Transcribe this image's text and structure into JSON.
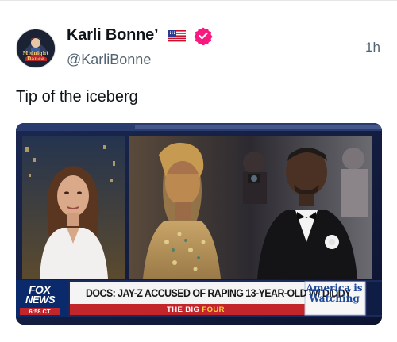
{
  "author": {
    "name": "Karli Bonne’",
    "flag_icon": "us-flag-icon",
    "verified_icon": "verified-badge-icon",
    "handle": "@KarliBonne",
    "timestamp": "1h",
    "avatar_text": "Midnight Dance"
  },
  "tweet": {
    "text": "Tip of the iceberg"
  },
  "media": {
    "network_logo_line1": "FOX",
    "network_logo_line2": "NEWS",
    "clock": "6:58 CT",
    "headline": "DOCS: JAY-Z ACCUSED OF RAPING 13-YEAR-OLD W/ DIDDY",
    "show_name_part1": "THE BIG",
    "show_name_part2": "FOUR",
    "promo_line1": "America is",
    "promo_line2": "Watching",
    "colors": {
      "chyron_red": "#c2262b",
      "fox_blue": "#0a2a6b",
      "promo_blue": "#1f4a9c",
      "show_highlight": "#ffd33b"
    }
  },
  "colors": {
    "verified": "#f91880",
    "secondary_text": "#536471"
  }
}
